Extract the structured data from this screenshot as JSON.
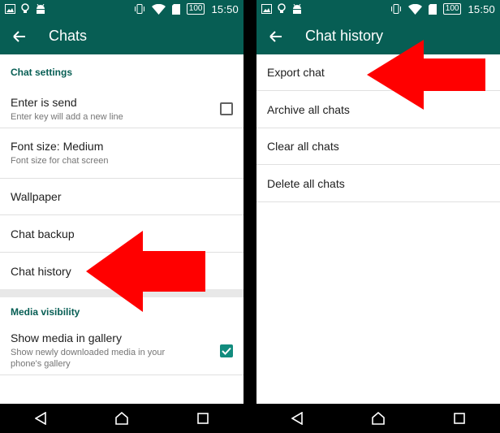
{
  "status_bar": {
    "time": "15:50",
    "battery": "100",
    "left_icons": [
      "image-icon",
      "bulb-icon",
      "android-icon"
    ],
    "right_icons": [
      "vibrate-icon",
      "wifi-icon",
      "sim-icon",
      "battery-icon"
    ]
  },
  "left_screen": {
    "title": "Chats",
    "sections": {
      "chat_settings": "Chat settings",
      "media_visibility": "Media visibility"
    },
    "items": {
      "enter_is_send": {
        "title": "Enter is send",
        "subtitle": "Enter key will add a new line",
        "checked": false
      },
      "font_size": {
        "title": "Font size: Medium",
        "subtitle": "Font size for chat screen"
      },
      "wallpaper": {
        "title": "Wallpaper"
      },
      "chat_backup": {
        "title": "Chat backup"
      },
      "chat_history": {
        "title": "Chat history"
      },
      "show_media": {
        "title": "Show media in gallery",
        "subtitle": "Show newly downloaded media in your phone's gallery",
        "checked": true
      }
    }
  },
  "right_screen": {
    "title": "Chat history",
    "items": [
      "Export chat",
      "Archive all chats",
      "Clear all chats",
      "Delete all chats"
    ]
  },
  "colors": {
    "primary": "#075e54",
    "accent": "#128c7e",
    "arrow": "#ff0000"
  }
}
